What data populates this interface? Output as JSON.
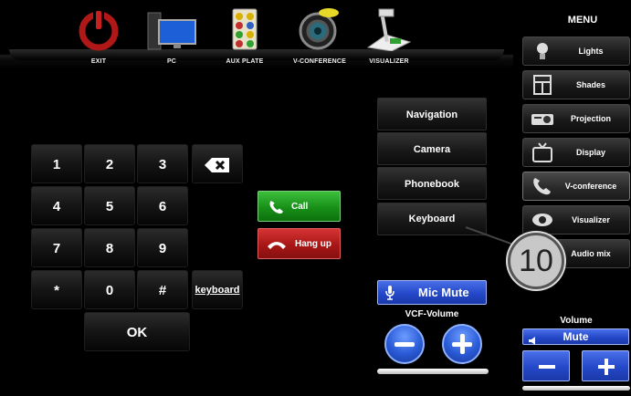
{
  "sources": [
    {
      "label": "EXIT",
      "icon": "power-icon"
    },
    {
      "label": "PC",
      "icon": "pc-icon"
    },
    {
      "label": "AUX PLATE",
      "icon": "aux-plate-icon"
    },
    {
      "label": "V-CONFERENCE",
      "icon": "camera-icon"
    },
    {
      "label": "VISUALIZER",
      "icon": "visualizer-icon"
    }
  ],
  "menu": {
    "title": "MENU",
    "items": [
      {
        "label": "Lights",
        "icon": "bulb-icon"
      },
      {
        "label": "Shades",
        "icon": "window-icon"
      },
      {
        "label": "Projection",
        "icon": "projector-icon"
      },
      {
        "label": "Display",
        "icon": "tv-icon"
      },
      {
        "label": "V-conference",
        "icon": "phone-icon"
      },
      {
        "label": "Visualizer",
        "icon": "eye-icon"
      },
      {
        "label": "Audio mix",
        "icon": "mixer-icon"
      }
    ]
  },
  "keypad": {
    "keys": [
      "1",
      "2",
      "3",
      "4",
      "5",
      "6",
      "7",
      "8",
      "9",
      "*",
      "0",
      "#"
    ],
    "keyboard_label": "keyboard",
    "ok_label": "OK"
  },
  "call": {
    "call_label": "Call",
    "hangup_label": "Hang up"
  },
  "tabs": {
    "navigation": "Navigation",
    "camera": "Camera",
    "phonebook": "Phonebook",
    "keyboard": "Keyboard"
  },
  "vcf": {
    "mic_mute_label": "Mic Mute",
    "volume_label": "VCF-Volume"
  },
  "room_volume": {
    "label": "Volume",
    "mute_label": "Mute"
  },
  "callout": {
    "number": "10"
  },
  "colors": {
    "accent_blue": "#2448c8",
    "active_green": "#189018",
    "hangup_red": "#a81616"
  }
}
